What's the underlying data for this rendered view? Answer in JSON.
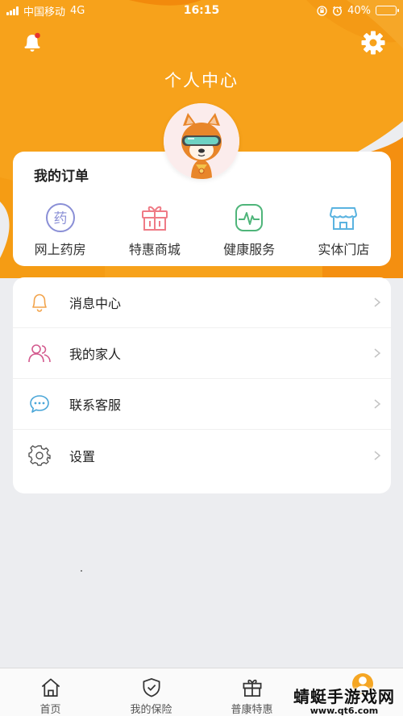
{
  "status_bar": {
    "carrier": "中国移动",
    "network": "4G",
    "time": "16:15",
    "battery": "40%",
    "battery_level": 0.4
  },
  "header": {
    "title": "个人中心",
    "bell_icon": "bell-icon",
    "settings_icon": "gear-icon",
    "brand_color": "#f7a21b"
  },
  "orders": {
    "title": "我的订单",
    "items": [
      {
        "label": "网上药房",
        "icon": "pharmacy-icon",
        "color": "#8a8fd6"
      },
      {
        "label": "特惠商城",
        "icon": "gift-icon",
        "color": "#ef7b86"
      },
      {
        "label": "健康服务",
        "icon": "health-pulse-icon",
        "color": "#4fb57a"
      },
      {
        "label": "实体门店",
        "icon": "store-icon",
        "color": "#5ab3e0"
      }
    ]
  },
  "menu": {
    "items": [
      {
        "label": "消息中心",
        "icon": "bell-icon",
        "color": "#f2a34a"
      },
      {
        "label": "我的家人",
        "icon": "family-icon",
        "color": "#d35a8e"
      },
      {
        "label": "联系客服",
        "icon": "chat-icon",
        "color": "#4aa6d8"
      },
      {
        "label": "设置",
        "icon": "gear-icon",
        "color": "#555555"
      }
    ]
  },
  "tabs": [
    {
      "label": "首页",
      "icon": "home-icon"
    },
    {
      "label": "我的保险",
      "icon": "shield-icon"
    },
    {
      "label": "普康特惠",
      "icon": "gift-icon"
    },
    {
      "label": "",
      "icon": "user-icon"
    }
  ],
  "watermark": {
    "title": "蜻蜓手游戏网",
    "url": "www.qt6.com"
  }
}
